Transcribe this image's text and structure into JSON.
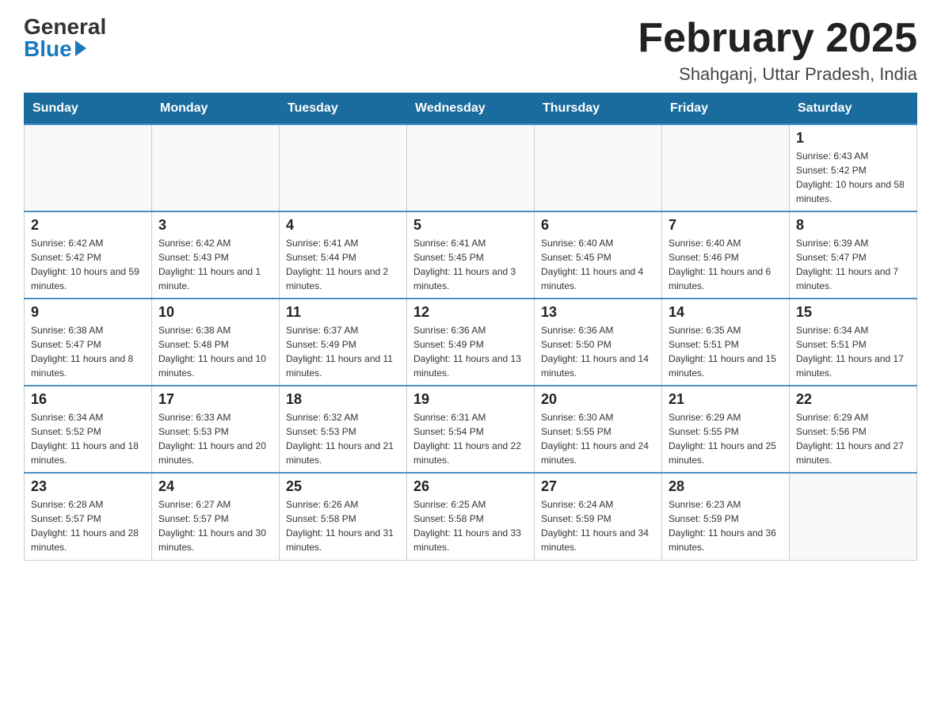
{
  "header": {
    "logo_general": "General",
    "logo_blue": "Blue",
    "month_title": "February 2025",
    "location": "Shahganj, Uttar Pradesh, India"
  },
  "weekdays": [
    "Sunday",
    "Monday",
    "Tuesday",
    "Wednesday",
    "Thursday",
    "Friday",
    "Saturday"
  ],
  "weeks": [
    [
      {
        "day": "",
        "sunrise": "",
        "sunset": "",
        "daylight": ""
      },
      {
        "day": "",
        "sunrise": "",
        "sunset": "",
        "daylight": ""
      },
      {
        "day": "",
        "sunrise": "",
        "sunset": "",
        "daylight": ""
      },
      {
        "day": "",
        "sunrise": "",
        "sunset": "",
        "daylight": ""
      },
      {
        "day": "",
        "sunrise": "",
        "sunset": "",
        "daylight": ""
      },
      {
        "day": "",
        "sunrise": "",
        "sunset": "",
        "daylight": ""
      },
      {
        "day": "1",
        "sunrise": "Sunrise: 6:43 AM",
        "sunset": "Sunset: 5:42 PM",
        "daylight": "Daylight: 10 hours and 58 minutes."
      }
    ],
    [
      {
        "day": "2",
        "sunrise": "Sunrise: 6:42 AM",
        "sunset": "Sunset: 5:42 PM",
        "daylight": "Daylight: 10 hours and 59 minutes."
      },
      {
        "day": "3",
        "sunrise": "Sunrise: 6:42 AM",
        "sunset": "Sunset: 5:43 PM",
        "daylight": "Daylight: 11 hours and 1 minute."
      },
      {
        "day": "4",
        "sunrise": "Sunrise: 6:41 AM",
        "sunset": "Sunset: 5:44 PM",
        "daylight": "Daylight: 11 hours and 2 minutes."
      },
      {
        "day": "5",
        "sunrise": "Sunrise: 6:41 AM",
        "sunset": "Sunset: 5:45 PM",
        "daylight": "Daylight: 11 hours and 3 minutes."
      },
      {
        "day": "6",
        "sunrise": "Sunrise: 6:40 AM",
        "sunset": "Sunset: 5:45 PM",
        "daylight": "Daylight: 11 hours and 4 minutes."
      },
      {
        "day": "7",
        "sunrise": "Sunrise: 6:40 AM",
        "sunset": "Sunset: 5:46 PM",
        "daylight": "Daylight: 11 hours and 6 minutes."
      },
      {
        "day": "8",
        "sunrise": "Sunrise: 6:39 AM",
        "sunset": "Sunset: 5:47 PM",
        "daylight": "Daylight: 11 hours and 7 minutes."
      }
    ],
    [
      {
        "day": "9",
        "sunrise": "Sunrise: 6:38 AM",
        "sunset": "Sunset: 5:47 PM",
        "daylight": "Daylight: 11 hours and 8 minutes."
      },
      {
        "day": "10",
        "sunrise": "Sunrise: 6:38 AM",
        "sunset": "Sunset: 5:48 PM",
        "daylight": "Daylight: 11 hours and 10 minutes."
      },
      {
        "day": "11",
        "sunrise": "Sunrise: 6:37 AM",
        "sunset": "Sunset: 5:49 PM",
        "daylight": "Daylight: 11 hours and 11 minutes."
      },
      {
        "day": "12",
        "sunrise": "Sunrise: 6:36 AM",
        "sunset": "Sunset: 5:49 PM",
        "daylight": "Daylight: 11 hours and 13 minutes."
      },
      {
        "day": "13",
        "sunrise": "Sunrise: 6:36 AM",
        "sunset": "Sunset: 5:50 PM",
        "daylight": "Daylight: 11 hours and 14 minutes."
      },
      {
        "day": "14",
        "sunrise": "Sunrise: 6:35 AM",
        "sunset": "Sunset: 5:51 PM",
        "daylight": "Daylight: 11 hours and 15 minutes."
      },
      {
        "day": "15",
        "sunrise": "Sunrise: 6:34 AM",
        "sunset": "Sunset: 5:51 PM",
        "daylight": "Daylight: 11 hours and 17 minutes."
      }
    ],
    [
      {
        "day": "16",
        "sunrise": "Sunrise: 6:34 AM",
        "sunset": "Sunset: 5:52 PM",
        "daylight": "Daylight: 11 hours and 18 minutes."
      },
      {
        "day": "17",
        "sunrise": "Sunrise: 6:33 AM",
        "sunset": "Sunset: 5:53 PM",
        "daylight": "Daylight: 11 hours and 20 minutes."
      },
      {
        "day": "18",
        "sunrise": "Sunrise: 6:32 AM",
        "sunset": "Sunset: 5:53 PM",
        "daylight": "Daylight: 11 hours and 21 minutes."
      },
      {
        "day": "19",
        "sunrise": "Sunrise: 6:31 AM",
        "sunset": "Sunset: 5:54 PM",
        "daylight": "Daylight: 11 hours and 22 minutes."
      },
      {
        "day": "20",
        "sunrise": "Sunrise: 6:30 AM",
        "sunset": "Sunset: 5:55 PM",
        "daylight": "Daylight: 11 hours and 24 minutes."
      },
      {
        "day": "21",
        "sunrise": "Sunrise: 6:29 AM",
        "sunset": "Sunset: 5:55 PM",
        "daylight": "Daylight: 11 hours and 25 minutes."
      },
      {
        "day": "22",
        "sunrise": "Sunrise: 6:29 AM",
        "sunset": "Sunset: 5:56 PM",
        "daylight": "Daylight: 11 hours and 27 minutes."
      }
    ],
    [
      {
        "day": "23",
        "sunrise": "Sunrise: 6:28 AM",
        "sunset": "Sunset: 5:57 PM",
        "daylight": "Daylight: 11 hours and 28 minutes."
      },
      {
        "day": "24",
        "sunrise": "Sunrise: 6:27 AM",
        "sunset": "Sunset: 5:57 PM",
        "daylight": "Daylight: 11 hours and 30 minutes."
      },
      {
        "day": "25",
        "sunrise": "Sunrise: 6:26 AM",
        "sunset": "Sunset: 5:58 PM",
        "daylight": "Daylight: 11 hours and 31 minutes."
      },
      {
        "day": "26",
        "sunrise": "Sunrise: 6:25 AM",
        "sunset": "Sunset: 5:58 PM",
        "daylight": "Daylight: 11 hours and 33 minutes."
      },
      {
        "day": "27",
        "sunrise": "Sunrise: 6:24 AM",
        "sunset": "Sunset: 5:59 PM",
        "daylight": "Daylight: 11 hours and 34 minutes."
      },
      {
        "day": "28",
        "sunrise": "Sunrise: 6:23 AM",
        "sunset": "Sunset: 5:59 PM",
        "daylight": "Daylight: 11 hours and 36 minutes."
      },
      {
        "day": "",
        "sunrise": "",
        "sunset": "",
        "daylight": ""
      }
    ]
  ]
}
